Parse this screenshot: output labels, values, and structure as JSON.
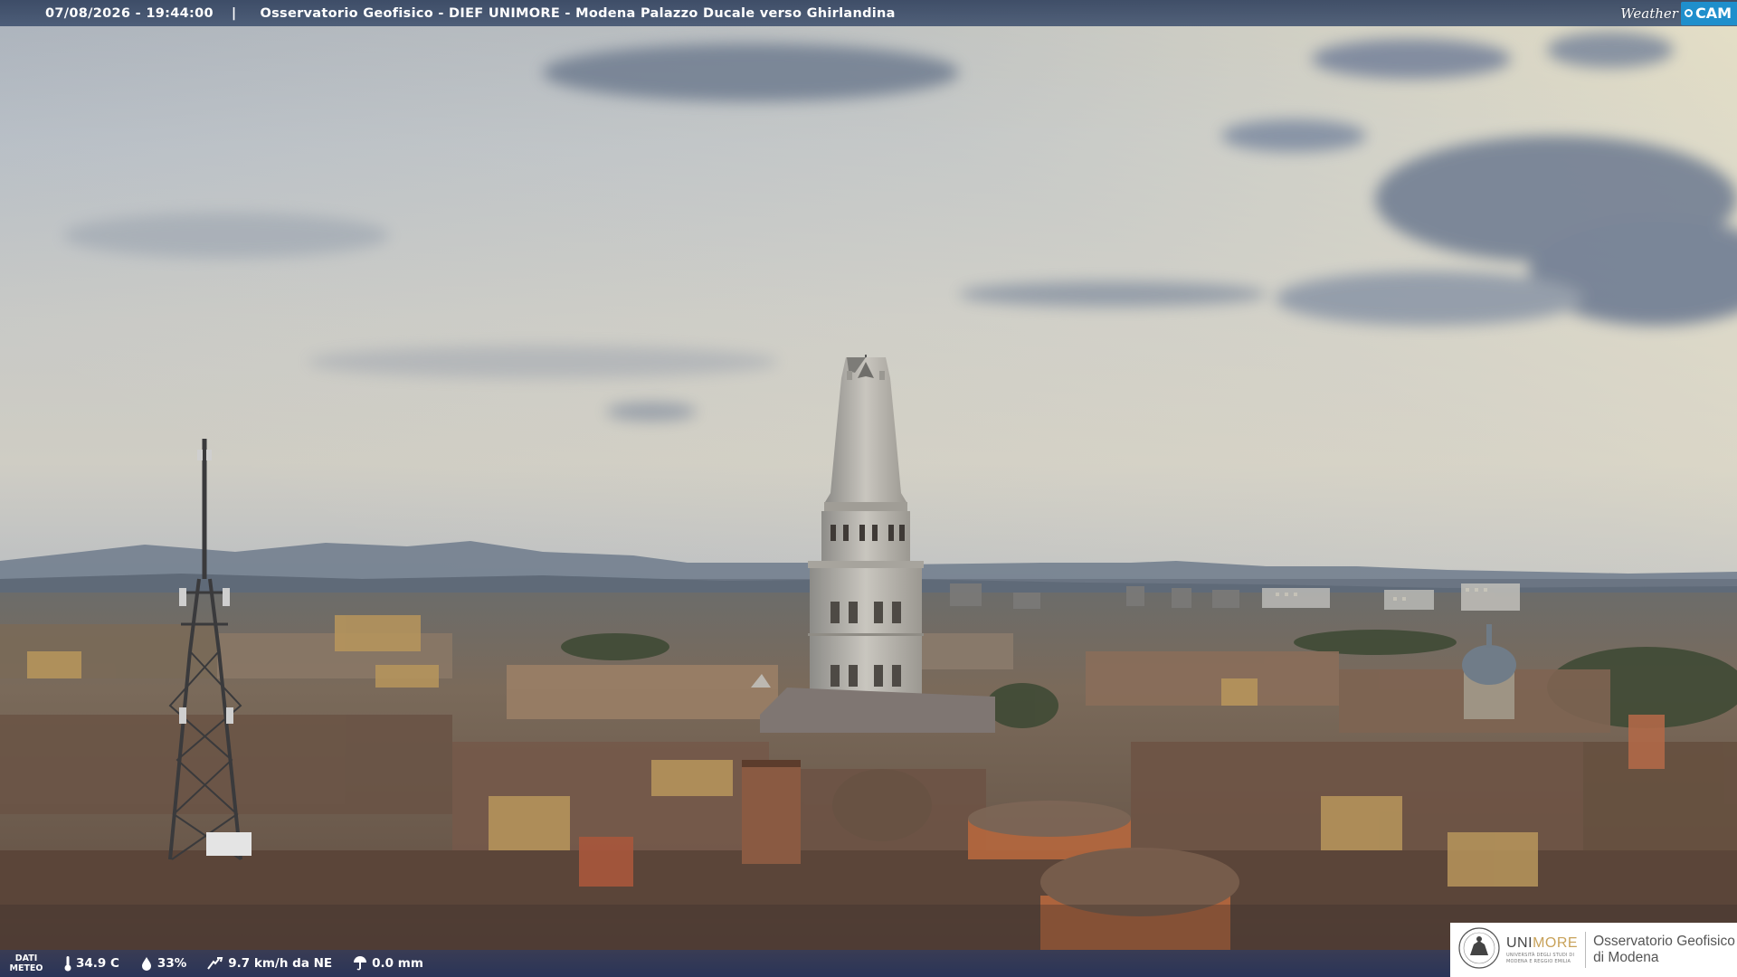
{
  "header": {
    "timestamp": "07/08/2026 - 19:44:00",
    "separator": "|",
    "title": "Osservatorio Geofisico - DIEF UNIMORE - Modena Palazzo Ducale verso Ghirlandina"
  },
  "brand": {
    "weather": "Weather",
    "cam": "CAM"
  },
  "meteo": {
    "label_line1": "DATI",
    "label_line2": "METEO",
    "temperature": "34.9 C",
    "humidity": "33%",
    "wind": "9.7 km/h da NE",
    "rain": "0.0 mm"
  },
  "logo": {
    "uni_prefix": "UNI",
    "uni_suffix": "MORE",
    "uni_sub_line1": "UNIVERSITÀ DEGLI STUDI DI",
    "uni_sub_line2": "MODENA E REGGIO EMILIA",
    "obs_line1": "Osservatorio Geofisico",
    "obs_line2": "di Modena"
  },
  "icons": {
    "thermometer": "thermometer-icon",
    "humidity": "drop-icon",
    "wind": "wind-icon",
    "rain": "rain-gauge-icon",
    "cam": "camera-icon"
  },
  "colors": {
    "topbar": "#34445f",
    "cam_accent": "#1f8fcc",
    "logo_gold": "#c8a25a"
  }
}
